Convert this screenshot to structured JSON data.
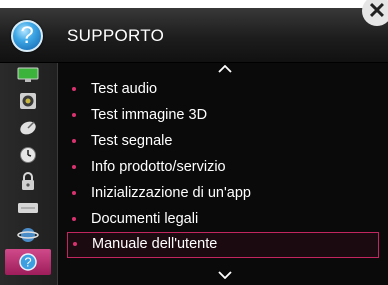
{
  "header": {
    "title": "SUPPORTO"
  },
  "sidebar": {
    "items": [
      {
        "icon": "monitor-icon"
      },
      {
        "icon": "speaker-icon"
      },
      {
        "icon": "satellite-icon"
      },
      {
        "icon": "clock-icon"
      },
      {
        "icon": "lock-icon"
      },
      {
        "icon": "keyboard-icon"
      },
      {
        "icon": "globe-icon"
      },
      {
        "icon": "help-icon",
        "active": true
      }
    ]
  },
  "menu": {
    "items": [
      {
        "label": "Test audio"
      },
      {
        "label": "Test immagine 3D"
      },
      {
        "label": "Test segnale"
      },
      {
        "label": "Info prodotto/servizio"
      },
      {
        "label": "Inizializzazione di un'app"
      },
      {
        "label": "Documenti legali"
      },
      {
        "label": "Manuale dell'utente",
        "selected": true
      }
    ]
  },
  "colors": {
    "accent": "#d9326f",
    "selected_border": "#c2265f",
    "background": "#0a0a0a"
  }
}
